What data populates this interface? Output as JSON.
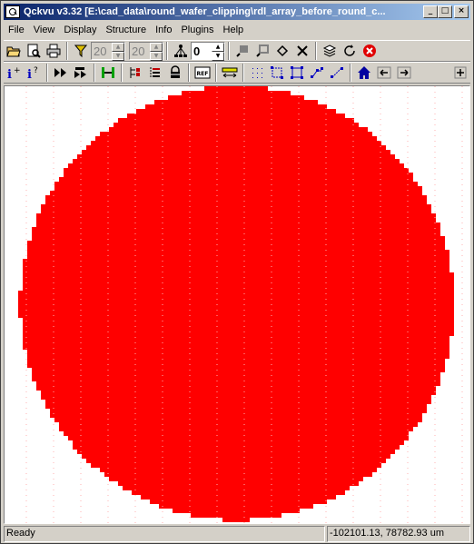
{
  "window": {
    "title": "Qckvu v3.32 [E:\\cad_data\\round_wafer_clipping\\rdl_array_before_round_c...",
    "buttons": {
      "minimize": "_",
      "maximize": "□",
      "close": "×"
    }
  },
  "menu": [
    "File",
    "View",
    "Display",
    "Structure",
    "Info",
    "Plugins",
    "Help"
  ],
  "toolbar": {
    "spin_min": "20",
    "spin_max": "20",
    "layer_value": "0"
  },
  "canvas": {
    "shape": "filled-circle",
    "fill_color": "#ff0000",
    "background_color": "#ffffff"
  },
  "status": {
    "text": "Ready",
    "coords": "-102101.13, 78782.93 um"
  },
  "colors": {
    "titlebar_start": "#0a246a",
    "titlebar_end": "#a6caf0",
    "chrome": "#d4d0c8",
    "wafer": "#ff0000"
  }
}
